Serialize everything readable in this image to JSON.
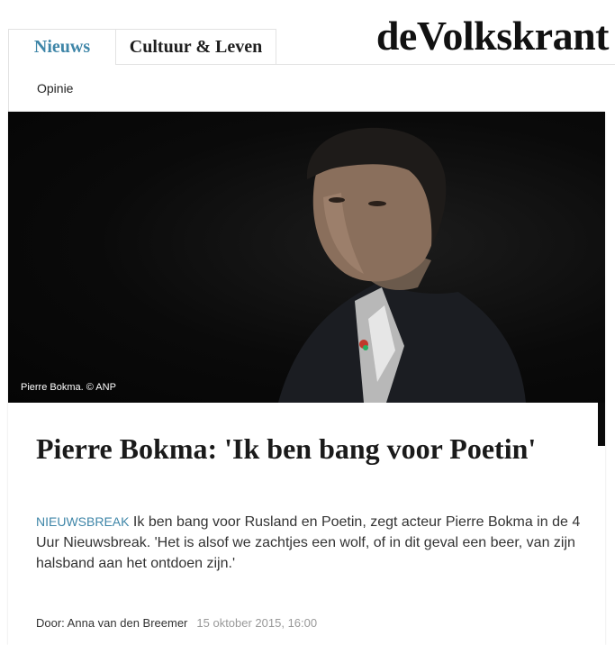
{
  "header": {
    "tabs": [
      {
        "label": "Nieuws",
        "active": true
      },
      {
        "label": "Cultuur & Leven",
        "active": false
      }
    ],
    "logo_text": "deVolkskrant",
    "subnav": [
      "Opinie"
    ]
  },
  "article": {
    "photo_caption": "Pierre Bokma. © ANP",
    "title": "Pierre Bokma: 'Ik ben bang voor Poetin'",
    "rubric": "NIEUWSBREAK",
    "lead": "Ik ben bang voor Rusland en Poetin, zegt acteur Pierre Bokma in de 4 Uur Nieuwsbreak. 'Het is alsof we zachtjes een wolf, of in dit geval een beer, van zijn halsband aan het ontdoen zijn.'",
    "byline": "Door: Anna van den Breemer",
    "date": "15 oktober 2015, 16:00"
  },
  "colors": {
    "accent": "#3f86a8",
    "text": "#1a1a1a",
    "muted": "#999999"
  }
}
